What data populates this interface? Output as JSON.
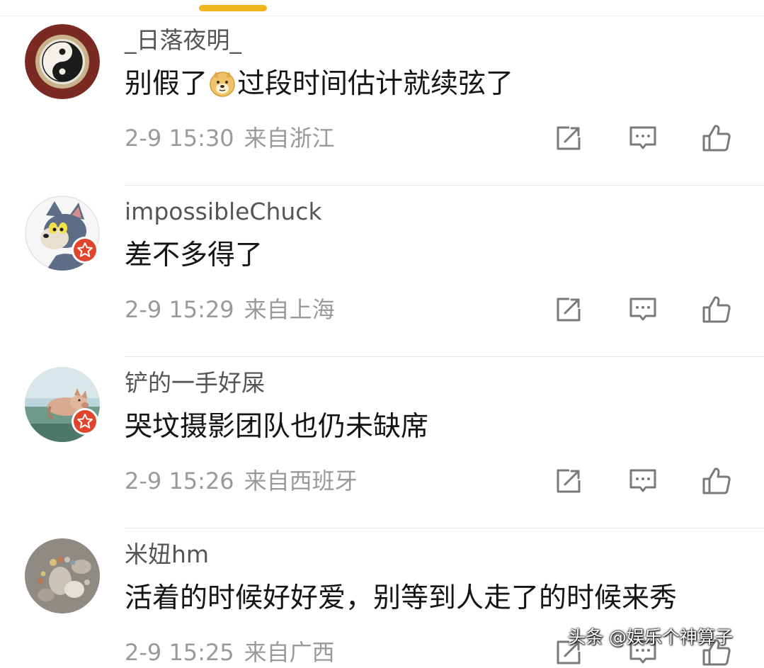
{
  "comments": [
    {
      "username": "_日落夜明_",
      "content_before": "别假了",
      "content_emoji": "doge-emoji",
      "content_after": "过段时间估计就续弦了",
      "time": "2-9 15:30",
      "location": "来自浙江",
      "avatar": "yin-yang-avatar",
      "verified": false
    },
    {
      "username": "impossibleChuck",
      "content": "差不多得了",
      "time": "2-9 15:29",
      "location": "来自上海",
      "avatar": "cartoon-cat-avatar",
      "verified": true
    },
    {
      "username": "铲的一手好屎",
      "content": "哭坟摄影团队也仍未缺席",
      "time": "2-9 15:26",
      "location": "来自西班牙",
      "avatar": "swimming-pig-avatar",
      "verified": true
    },
    {
      "username": "米妞hm",
      "content": "活着的时候好好爱，别等到人走了的时候来秀",
      "time": "2-9 15:25",
      "location": "来自广西",
      "avatar": "pebble-footprints-avatar",
      "verified": false
    }
  ],
  "actions": {
    "edit_icon": "share-edit-icon",
    "reply_icon": "comment-reply-icon",
    "like_icon": "thumbs-up-icon"
  },
  "watermark": "头条 @娱乐个神算子",
  "colors": {
    "accent_indicator": "#f2b51e",
    "badge_red": "#e0452b",
    "username": "#555555",
    "content": "#151515",
    "meta": "#9a9a9a"
  }
}
